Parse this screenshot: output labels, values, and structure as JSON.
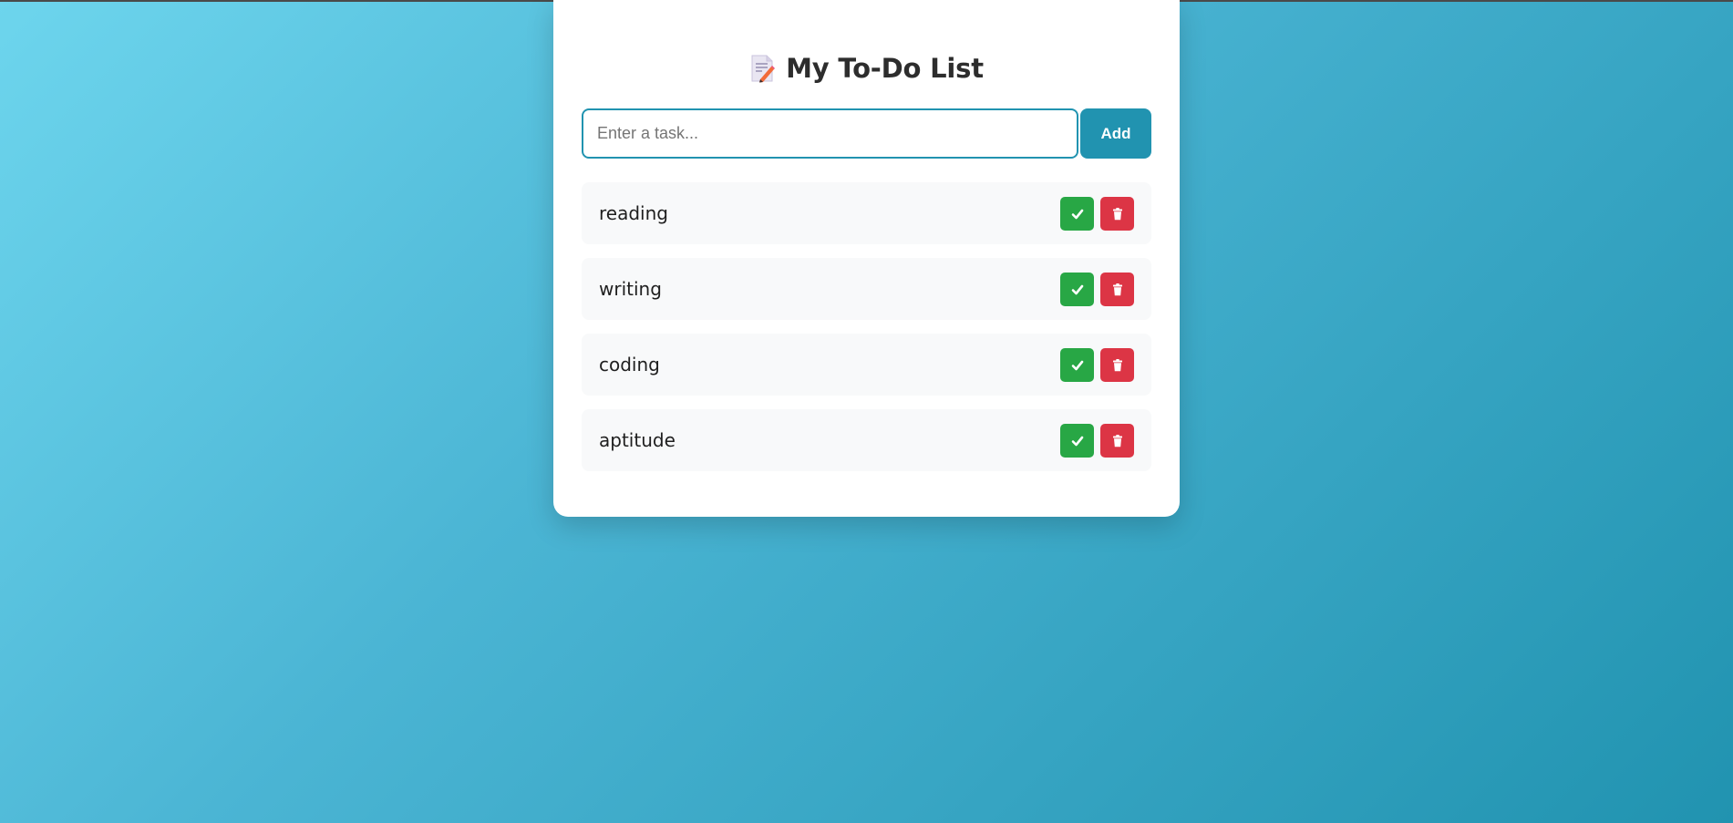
{
  "header": {
    "title": "My To-Do List",
    "icon": "memo-icon"
  },
  "input": {
    "placeholder": "Enter a task...",
    "value": ""
  },
  "add_button": {
    "label": "Add"
  },
  "tasks": [
    {
      "text": "reading"
    },
    {
      "text": "writing"
    },
    {
      "text": "coding"
    },
    {
      "text": "aptitude"
    }
  ],
  "colors": {
    "accent": "#2193b0",
    "complete": "#28a745",
    "delete": "#dc3545",
    "background_start": "#6dd5ed",
    "background_end": "#2193b0"
  }
}
